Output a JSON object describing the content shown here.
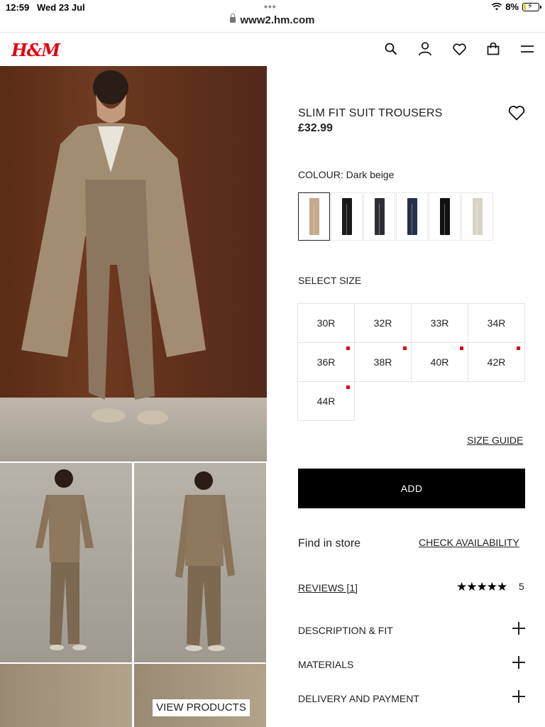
{
  "status_bar": {
    "time": "12:59",
    "date": "Wed 23 Jul",
    "battery": "8%"
  },
  "browser": {
    "url": "www2.hm.com"
  },
  "header": {
    "logo": "H&M",
    "icons": [
      "search-icon",
      "account-icon",
      "favourites-icon",
      "shopping-bag-icon",
      "menu-icon"
    ]
  },
  "gallery": {
    "view_products": "VIEW PRODUCTS"
  },
  "product": {
    "title": "SLIM FIT SUIT TROUSERS",
    "price": "£32.99",
    "colour_label": "COLOUR: Dark beige",
    "swatch_colors": [
      "#c4a98b",
      "#1a1a1a",
      "#2e2f33",
      "#26304a",
      "#121214",
      "#d9d3c4"
    ],
    "selected_swatch": 0,
    "size_label": "SELECT SIZE",
    "sizes": [
      "30R",
      "32R",
      "33R",
      "34R",
      "36R",
      "38R",
      "40R",
      "42R",
      "44R"
    ],
    "low_stock_sizes": [
      "36R",
      "38R",
      "40R",
      "42R",
      "44R"
    ],
    "size_guide": "SIZE GUIDE",
    "add_label": "ADD",
    "find_in_store": "Find in store",
    "check_availability": "CHECK AVAILABILITY",
    "reviews": "REVIEWS [1]",
    "stars": "★★★★★",
    "rating": "5",
    "accordions": [
      "DESCRIPTION & FIT",
      "MATERIALS",
      "DELIVERY AND PAYMENT"
    ]
  },
  "colors": {
    "brand_red": "#e50010",
    "button_black": "#000000"
  }
}
